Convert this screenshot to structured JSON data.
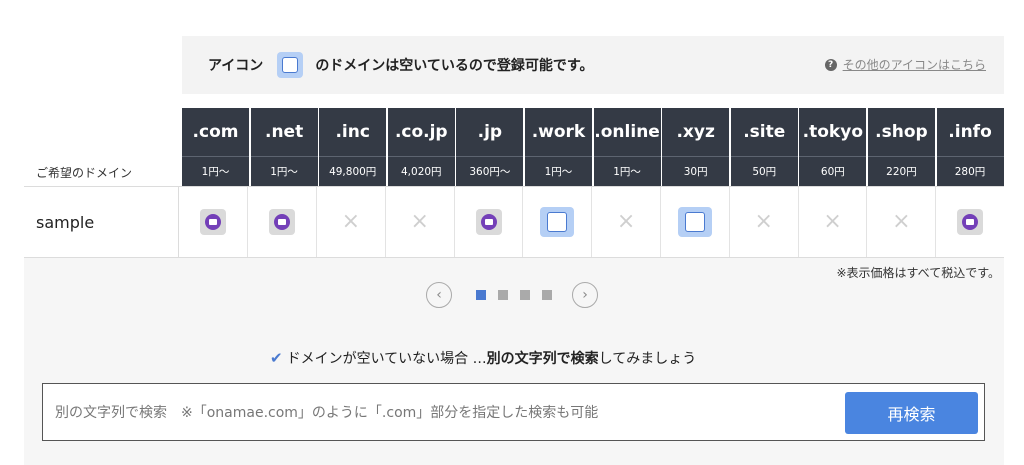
{
  "legend": {
    "lead": "アイコン",
    "tail": "のドメインは空いているので登録可能です。",
    "other_link": "その他のアイコンはこちら"
  },
  "wish_label": "ご希望のドメイン",
  "domains": [
    {
      "tld": ".com",
      "price": "1円〜"
    },
    {
      "tld": ".net",
      "price": "1円〜"
    },
    {
      "tld": ".inc",
      "price": "49,800円"
    },
    {
      "tld": ".co.jp",
      "price": "4,020円"
    },
    {
      "tld": ".jp",
      "price": "360円〜"
    },
    {
      "tld": ".work",
      "price": "1円〜"
    },
    {
      "tld": ".online",
      "price": "1円〜"
    },
    {
      "tld": ".xyz",
      "price": "30円"
    },
    {
      "tld": ".site",
      "price": "50円"
    },
    {
      "tld": ".tokyo",
      "price": "60円"
    },
    {
      "tld": ".shop",
      "price": "220円"
    },
    {
      "tld": ".info",
      "price": "280円"
    }
  ],
  "result": {
    "name": "sample",
    "status": [
      "taken-mail",
      "taken-mail",
      "unavailable",
      "unavailable",
      "taken-mail",
      "available",
      "unavailable",
      "available",
      "unavailable",
      "unavailable",
      "unavailable",
      "taken-mail"
    ],
    "unavailable_glyph": "×"
  },
  "tax_note": "※表示価格はすべて税込です。",
  "pager": {
    "prev": "‹",
    "next": "›",
    "pages": 4,
    "active": 0
  },
  "hint": {
    "check": "✔",
    "pre": "ドメインが空いていない場合 … ",
    "bold": "別の文字列で検索",
    "post": "してみましょう"
  },
  "search": {
    "placeholder": "別の文字列で検索　※「onamae.com」のように「.com」部分を指定した検索も可能",
    "button": "再検索"
  },
  "colors": {
    "header_bg": "#343a45",
    "available_bg": "#b5cff5",
    "accent": "#4a85e0",
    "mail_icon": "#7440b8"
  }
}
